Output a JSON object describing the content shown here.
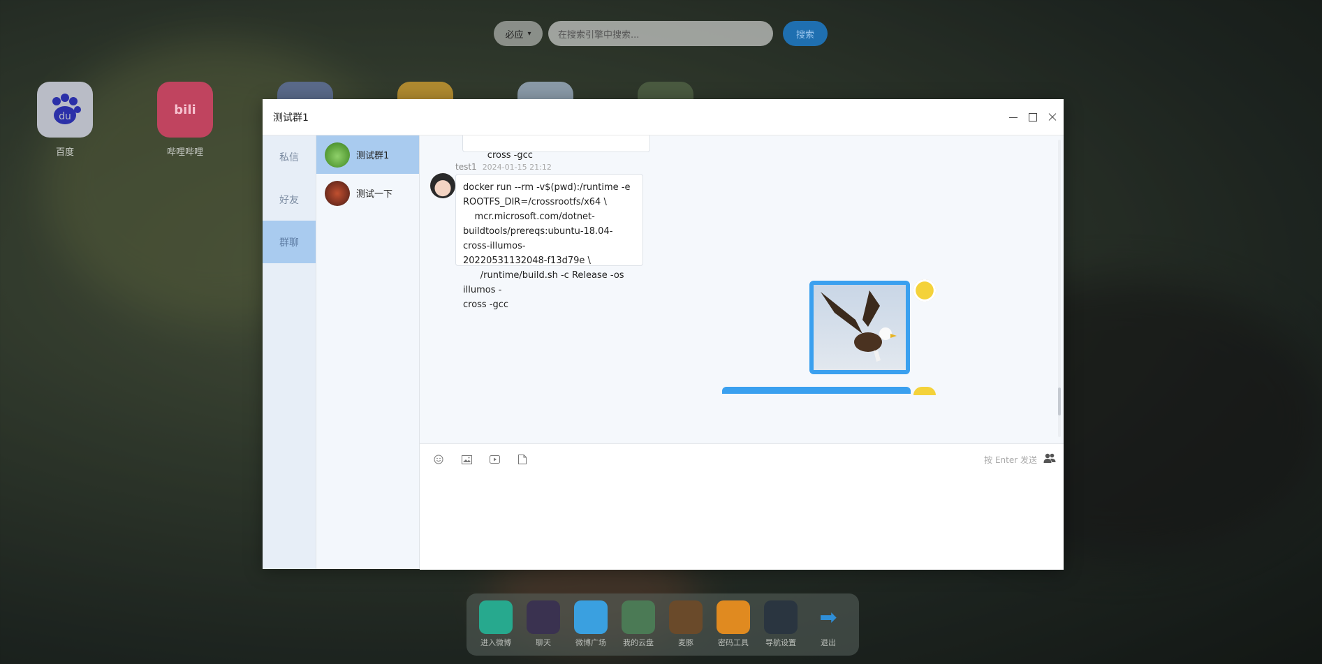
{
  "top_search": {
    "engine": "必应",
    "placeholder": "在搜索引擎中搜索...",
    "button": "搜索"
  },
  "desktop_icons": [
    {
      "label": "百度",
      "icon": "baidu-icon",
      "color": "#3b3fb8"
    },
    {
      "label": "哔哩哔哩",
      "icon": "bilibili-icon",
      "color": "#e05a7a"
    }
  ],
  "window": {
    "title": "测试群1",
    "nav": [
      "私信",
      "好友",
      "群聊"
    ],
    "active_nav": 2,
    "conversations": [
      {
        "name": "测试群1",
        "avatar": "frog-avatar",
        "active": true
      },
      {
        "name": "测试一下",
        "avatar": "building-avatar",
        "active": false
      }
    ],
    "messages": {
      "partial_tail": "cross -gcc",
      "msg1_sender": "test1",
      "msg1_time": "2024-01-15 21:12",
      "msg1_text": "docker run --rm -v$(pwd):/runtime -e\nROOTFS_DIR=/crossrootfs/x64 \\\n    mcr.microsoft.com/dotnet-\nbuildtools/prereqs:ubuntu-18.04-cross-illumos-\n20220531132048-f13d79e \\\n      /runtime/build.sh -c Release -os illumos -\ncross -gcc",
      "image_msg": "eagle-image"
    },
    "composer": {
      "tools": [
        "emoji-icon",
        "image-icon",
        "video-icon",
        "file-icon"
      ],
      "hint": "按 Enter 发送"
    }
  },
  "dock": [
    {
      "label": "进入微博",
      "color": "#27a98e"
    },
    {
      "label": "聊天",
      "color": "#3a3250"
    },
    {
      "label": "微博广场",
      "color": "#3aa0e0"
    },
    {
      "label": "我的云盘",
      "color": "#4b7a55"
    },
    {
      "label": "麦豚",
      "color": "#6a4a2a"
    },
    {
      "label": "密码工具",
      "color": "#e08a20"
    },
    {
      "label": "导航设置",
      "color": "#2a3540"
    },
    {
      "label": "退出",
      "color": "#2f8fd8"
    }
  ],
  "accent": "#a9cbef"
}
